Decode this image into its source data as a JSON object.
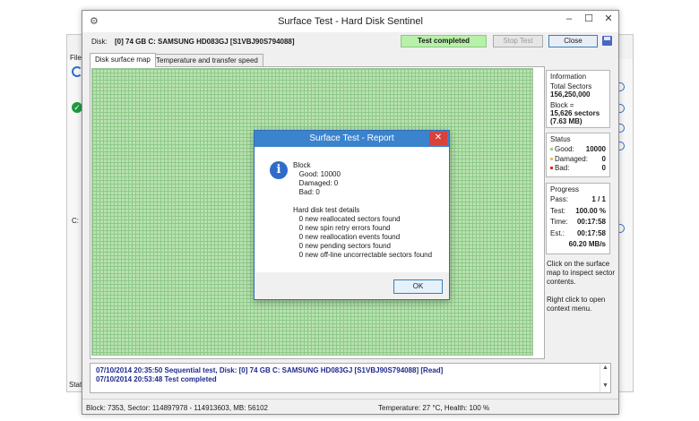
{
  "background_window": {
    "menu_label": "File",
    "drive_label": "C:",
    "status_label": "Stat"
  },
  "window": {
    "title": "Surface Test - Hard Disk Sentinel",
    "minimize_glyph": "–",
    "maximize_glyph": "☐",
    "close_glyph": "✕"
  },
  "toolbar": {
    "disk_label": "Disk:",
    "disk_value": "[0] 74 GB C: SAMSUNG HD083GJ [S1VBJ90S794088]",
    "test_status": "Test completed",
    "stop_label": "Stop Test",
    "close_label": "Close"
  },
  "tabs": [
    {
      "label": "Disk surface map",
      "active": true
    },
    {
      "label": "Temperature and transfer speed",
      "active": false
    }
  ],
  "info_panel": {
    "heading": "Information",
    "total_sectors_label": "Total Sectors",
    "total_sectors_value": "156,250,000",
    "block_label": "Block =",
    "block_sectors": "15,626 sectors",
    "block_size": "(7.63 MB)"
  },
  "status_panel": {
    "heading": "Status",
    "good_label": "Good:",
    "good_value": "10000",
    "damaged_label": "Damaged:",
    "damaged_value": "0",
    "bad_label": "Bad:",
    "bad_value": "0",
    "colors": {
      "good": "#9ad39a",
      "damaged": "#e0c060",
      "bad": "#d0302a"
    }
  },
  "progress_panel": {
    "heading": "Progress",
    "pass_label": "Pass:",
    "pass_value": "1 / 1",
    "test_label": "Test:",
    "test_value": "100.00 %",
    "time_label": "Time:",
    "time_value": "00:17:58",
    "est_label": "Est.:",
    "est_value": "00:17:58",
    "speed": "60.20 MB/s"
  },
  "hints": {
    "left_click": "Click on the surface map to inspect sector contents.",
    "right_click": "Right click to open context menu."
  },
  "log": {
    "lines": [
      "07/10/2014  20:35:50   Sequential test, Disk: [0] 74 GB C: SAMSUNG HD083GJ [S1VBJ90S794088] [Read]",
      "07/10/2014  20:53:48   Test completed"
    ]
  },
  "statusbar": {
    "left": "Block: 7353, Sector: 114897978 - 114913603, MB: 56102",
    "right": "Temperature: 27  °C,  Health: 100 %"
  },
  "dialog": {
    "title": "Surface Test - Report",
    "close_glyph": "✕",
    "icon_glyph": "i",
    "body": "Block\n   Good: 10000\n   Damaged: 0\n   Bad: 0\n\nHard disk test details\n   0 new reallocated sectors found\n   0 new spin retry errors found\n   0 new reallocation events found\n   0 new pending sectors found\n   0 new off-line uncorrectable sectors found",
    "ok_label": "OK"
  }
}
